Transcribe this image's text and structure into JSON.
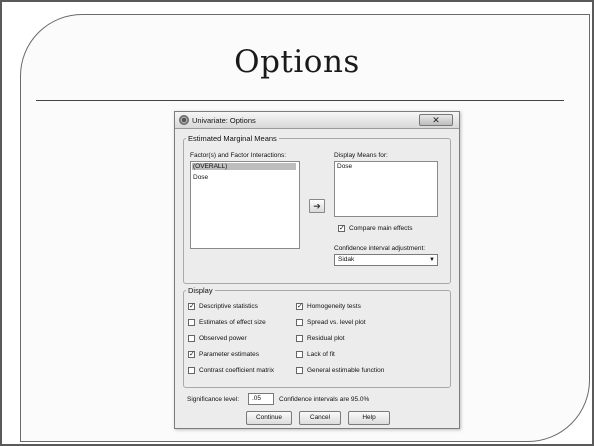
{
  "slide": {
    "title": "Options"
  },
  "dialog": {
    "title": "Univariate: Options",
    "close_glyph": "✕",
    "emm": {
      "legend": "Estimated Marginal Means",
      "factors_label": "Factor(s) and Factor Interactions:",
      "factors": [
        "(OVERALL)",
        "Dose"
      ],
      "move_glyph": "➔",
      "display_means_label": "Display Means for:",
      "display_means": [
        "Dose"
      ],
      "compare_label": "Compare main effects",
      "compare_checked": true,
      "ci_adjust_label": "Confidence interval adjustment:",
      "ci_adjust_value": "Sidak"
    },
    "display": {
      "legend": "Display",
      "options": [
        {
          "label": "Descriptive statistics",
          "checked": true
        },
        {
          "label": "Estimates of effect size",
          "checked": false
        },
        {
          "label": "Observed power",
          "checked": false
        },
        {
          "label": "Parameter estimates",
          "checked": true
        },
        {
          "label": "Contrast coefficient matrix",
          "checked": false
        },
        {
          "label": "Homogeneity tests",
          "checked": true
        },
        {
          "label": "Spread vs. level plot",
          "checked": false
        },
        {
          "label": "Residual plot",
          "checked": false
        },
        {
          "label": "Lack of fit",
          "checked": false
        },
        {
          "label": "General estimable function",
          "checked": false
        }
      ]
    },
    "significance": {
      "label": "Significance level:",
      "value": ".05",
      "note": "Confidence intervals are 95.0%"
    },
    "buttons": {
      "continue": "Continue",
      "cancel": "Cancel",
      "help": "Help"
    }
  }
}
